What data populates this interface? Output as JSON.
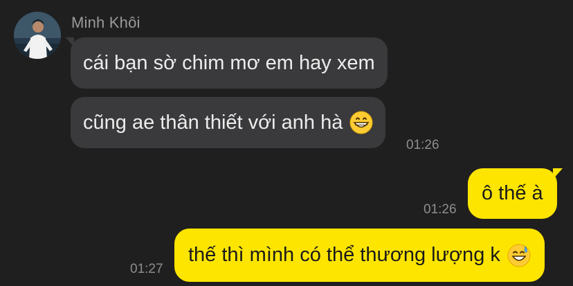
{
  "chat": {
    "sender": {
      "name": "Minh Khôi",
      "avatar_icon": "profile-photo"
    },
    "messages": [
      {
        "direction": "incoming",
        "text": "cái bạn sờ chim mơ em hay xem",
        "emoji": null
      },
      {
        "direction": "incoming",
        "text": "cũng ae thân thiết với anh hà",
        "emoji": "grinning-face-icon",
        "time": "01:26"
      },
      {
        "direction": "outgoing",
        "text": "ô thế à",
        "emoji": null,
        "time": "01:26"
      },
      {
        "direction": "outgoing",
        "text": "thế thì mình có thể thương lượng k",
        "emoji": "sweat-smile-icon",
        "time": "01:27"
      }
    ]
  },
  "colors": {
    "background": "#1f1f1f",
    "incoming_bubble": "#3a3a3c",
    "outgoing_bubble": "#fee500",
    "timestamp": "#8e8e8e",
    "sender_name": "#9a9a9a"
  }
}
